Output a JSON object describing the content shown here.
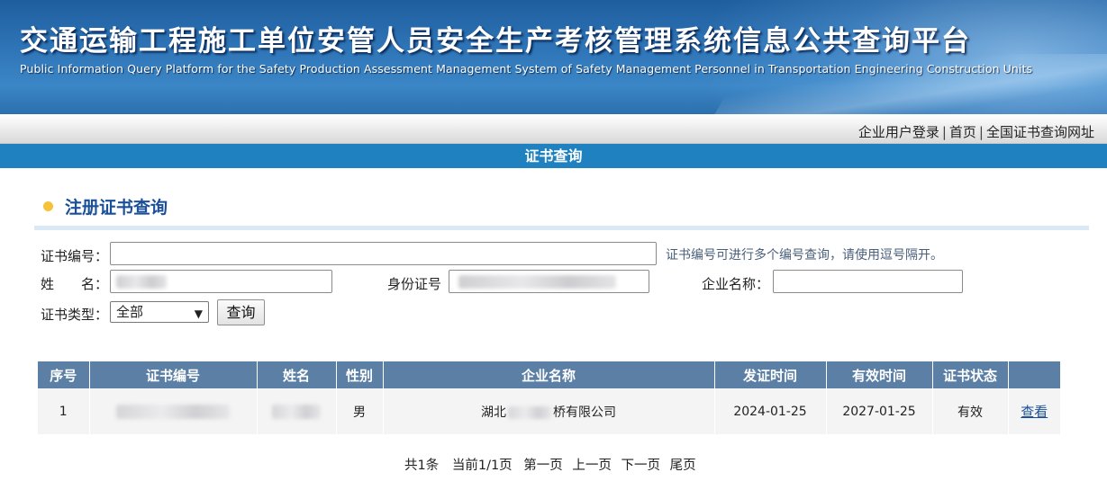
{
  "banner": {
    "title": "交通运输工程施工单位安管人员安全生产考核管理系统信息公共查询平台",
    "subtitle": "Public Information Query Platform for the Safety Production Assessment Management System of Safety Management Personnel in Transportation Engineering Construction Units"
  },
  "nav": {
    "links": [
      "企业用户登录",
      "首页",
      "全国证书查询网址"
    ],
    "separator": "|"
  },
  "section": {
    "title": "证书查询"
  },
  "heading": "注册证书查询",
  "form": {
    "cert_no": {
      "label": "证书编号：",
      "value": "",
      "hint": "证书编号可进行多个编号查询，请使用逗号隔开。"
    },
    "name": {
      "label": "姓　　名："
    },
    "id_no": {
      "label": "身份证号"
    },
    "company": {
      "label": "企业名称：",
      "value": ""
    },
    "cert_type": {
      "label": "证书类型：",
      "selected": "全部"
    },
    "search_button": "查询"
  },
  "table": {
    "headers": [
      "序号",
      "证书编号",
      "姓名",
      "性别",
      "企业名称",
      "发证时间",
      "有效时间",
      "证书状态",
      ""
    ],
    "rows": [
      {
        "index": "1",
        "gender": "男",
        "company_prefix": "湖北",
        "company_suffix": "桥有限公司",
        "issue_date": "2024-01-25",
        "valid_date": "2027-01-25",
        "status": "有效",
        "action": "查看"
      }
    ]
  },
  "pagination": {
    "total": "共1条",
    "current": "当前1/1页",
    "first": "第一页",
    "prev": "上一页",
    "next": "下一页",
    "last": "尾页"
  },
  "colors": {
    "banner_blue": "#2f76b8",
    "section_bar": "#1f81c0",
    "table_header": "#5b7fa5",
    "heading_text": "#1a4f9a",
    "heading_dot": "#f5c23a"
  }
}
